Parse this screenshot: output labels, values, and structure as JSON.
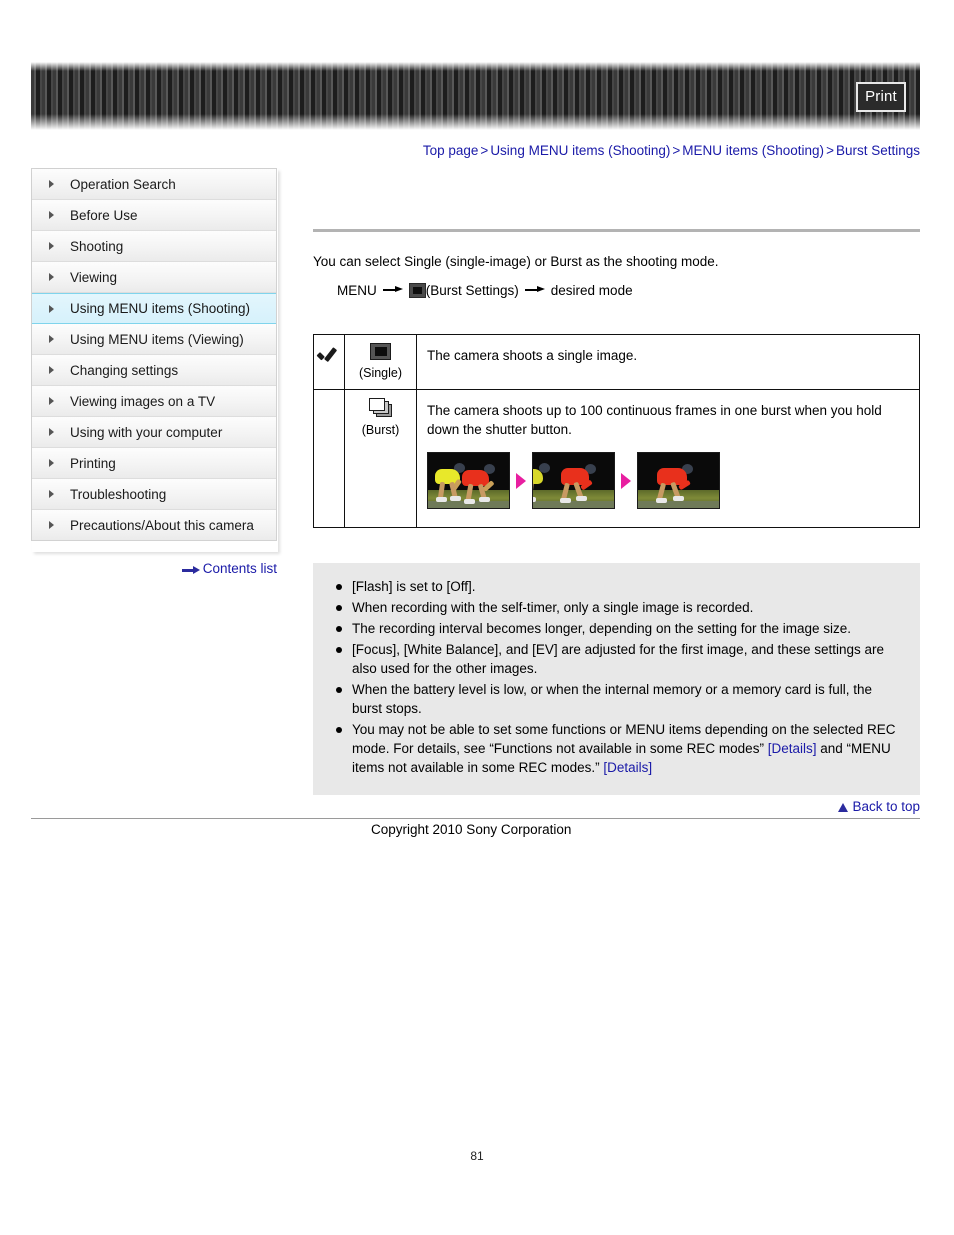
{
  "header": {
    "print_label": "Print"
  },
  "breadcrumb": {
    "separator": ">",
    "items": [
      "Top page",
      "Using MENU items (Shooting)",
      "MENU items (Shooting)",
      "Burst Settings"
    ]
  },
  "sidebar": {
    "items": [
      {
        "label": "Operation Search",
        "selected": false
      },
      {
        "label": "Before Use",
        "selected": false
      },
      {
        "label": "Shooting",
        "selected": false
      },
      {
        "label": "Viewing",
        "selected": false
      },
      {
        "label": "Using MENU items (Shooting)",
        "selected": true
      },
      {
        "label": "Using MENU items (Viewing)",
        "selected": false
      },
      {
        "label": "Changing settings",
        "selected": false
      },
      {
        "label": "Viewing images on a TV",
        "selected": false
      },
      {
        "label": "Using with your computer",
        "selected": false
      },
      {
        "label": "Printing",
        "selected": false
      },
      {
        "label": "Troubleshooting",
        "selected": false
      },
      {
        "label": "Precautions/About this camera",
        "selected": false
      }
    ],
    "contents_list_label": "Contents list"
  },
  "main": {
    "intro": "You can select Single (single-image) or Burst as the shooting mode.",
    "menu_path": {
      "prefix": "MENU",
      "icon_label": "(Burst Settings)",
      "suffix": "desired mode"
    },
    "table": {
      "rows": [
        {
          "checked": true,
          "mode_label": "(Single)",
          "mode_icon": "single-frame-icon",
          "description": "The camera shoots a single image."
        },
        {
          "checked": false,
          "mode_label": "(Burst)",
          "mode_icon": "burst-frames-icon",
          "description": "The camera shoots up to 100 continuous frames in one burst when you hold down the shutter button.",
          "photos": [
            "burst-photo-frame-1",
            "burst-photo-frame-2",
            "burst-photo-frame-3"
          ]
        }
      ]
    },
    "notes": [
      {
        "text": "[Flash] is set to [Off]."
      },
      {
        "text": "When recording with the self-timer, only a single image is recorded."
      },
      {
        "text": "The recording interval becomes longer, depending on the setting for the image size."
      },
      {
        "text": "[Focus], [White Balance], and [EV] are adjusted for the first image, and these settings are also used for the other images."
      },
      {
        "text": "When the battery level is low, or when the internal memory or a memory card is full, the burst stops."
      },
      {
        "text_part1": "You may not be able to set some functions or MENU items depending on the selected REC mode. For details, see “Functions not available in some REC modes” ",
        "link1": "[Details]",
        "text_part2": " and “MENU items not available in some REC modes.” ",
        "link2": "[Details]"
      }
    ]
  },
  "footer": {
    "back_to_top_label": "Back to top",
    "copyright": "Copyright 2010 Sony Corporation",
    "page_number": "81"
  }
}
